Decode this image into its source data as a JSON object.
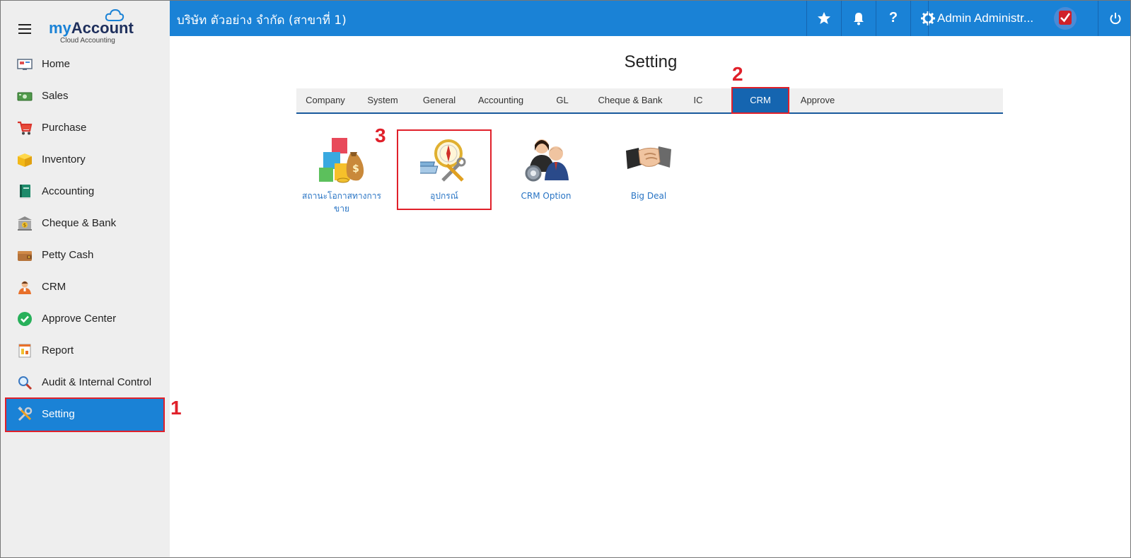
{
  "brand": {
    "my": "my",
    "account": "Account",
    "sub": "Cloud Accounting"
  },
  "topbar": {
    "company": "บริษัท ตัวอย่าง จำกัด (สาขาที่ 1)",
    "user": "Admin Administr...",
    "help_label": "?"
  },
  "sidebar": {
    "items": [
      {
        "label": "Home",
        "icon": "home-icon"
      },
      {
        "label": "Sales",
        "icon": "sales-icon"
      },
      {
        "label": "Purchase",
        "icon": "cart-icon"
      },
      {
        "label": "Inventory",
        "icon": "box-icon"
      },
      {
        "label": "Accounting",
        "icon": "ledger-icon"
      },
      {
        "label": "Cheque & Bank",
        "icon": "bank-icon"
      },
      {
        "label": "Petty Cash",
        "icon": "wallet-icon"
      },
      {
        "label": "CRM",
        "icon": "people-icon"
      },
      {
        "label": "Approve Center",
        "icon": "check-circle-icon"
      },
      {
        "label": "Report",
        "icon": "report-icon"
      },
      {
        "label": "Audit & Internal Control",
        "icon": "magnifier-icon"
      },
      {
        "label": "Setting",
        "icon": "tools-icon",
        "active": true
      }
    ]
  },
  "markers": {
    "one": "1",
    "two": "2",
    "three": "3"
  },
  "page": {
    "title": "Setting",
    "tabs": [
      {
        "label": "Company"
      },
      {
        "label": "System"
      },
      {
        "label": "General"
      },
      {
        "label": "Accounting"
      },
      {
        "label": "GL"
      },
      {
        "label": "Cheque & Bank"
      },
      {
        "label": "IC"
      },
      {
        "label": "CRM",
        "active": true
      },
      {
        "label": "Approve"
      }
    ],
    "tiles": [
      {
        "label": "สถานะโอกาสทางการขาย",
        "icon": "blocks-moneybag-icon"
      },
      {
        "label": "อุปกรณ์",
        "icon": "compass-tools-icon"
      },
      {
        "label": "CRM Option",
        "icon": "business-people-gear-icon"
      },
      {
        "label": "Big Deal",
        "icon": "handshake-icon"
      }
    ]
  },
  "colors": {
    "primary": "#1a82d6",
    "tab_active": "#1565b0",
    "highlight": "#e0202a",
    "sidebar_bg": "#eeeeee"
  }
}
